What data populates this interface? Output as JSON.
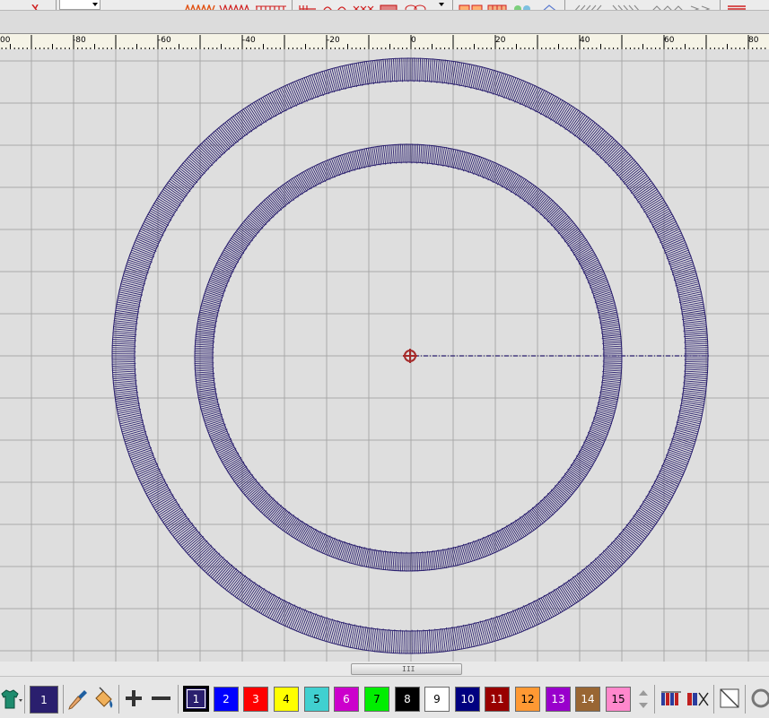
{
  "ruler": {
    "labels": [
      "-80",
      "-60",
      "-40",
      "-20",
      "0",
      "20",
      "40",
      "60",
      "80"
    ],
    "edge_label_left": "00",
    "edge_label_right": "80"
  },
  "canvas": {
    "thread_color": "#2a1f6e",
    "center_marker_color": "#a52a2a"
  },
  "scrollbar": {
    "grip": "III"
  },
  "colorbar": {
    "current_color_label": "1",
    "current_color_hex": "#2a1f6e",
    "swatches": [
      {
        "label": "1",
        "color": "#2a1f6e",
        "text": "#ffffff",
        "selected": true
      },
      {
        "label": "2",
        "color": "#0000ff",
        "text": "#ffffff"
      },
      {
        "label": "3",
        "color": "#ff0000",
        "text": "#ffffff"
      },
      {
        "label": "4",
        "color": "#ffff00",
        "text": "#000000"
      },
      {
        "label": "5",
        "color": "#40d0d0",
        "text": "#000000"
      },
      {
        "label": "6",
        "color": "#cc00cc",
        "text": "#ffffff"
      },
      {
        "label": "7",
        "color": "#00ee00",
        "text": "#000000"
      },
      {
        "label": "8",
        "color": "#000000",
        "text": "#ffffff"
      },
      {
        "label": "9",
        "color": "#ffffff",
        "text": "#000000"
      },
      {
        "label": "10",
        "color": "#000080",
        "text": "#ffffff"
      },
      {
        "label": "11",
        "color": "#990000",
        "text": "#ffffff"
      },
      {
        "label": "12",
        "color": "#ff9933",
        "text": "#000000"
      },
      {
        "label": "13",
        "color": "#9900cc",
        "text": "#ffffff"
      },
      {
        "label": "14",
        "color": "#996633",
        "text": "#ffffff"
      },
      {
        "label": "15",
        "color": "#ff88cc",
        "text": "#000000"
      }
    ]
  }
}
